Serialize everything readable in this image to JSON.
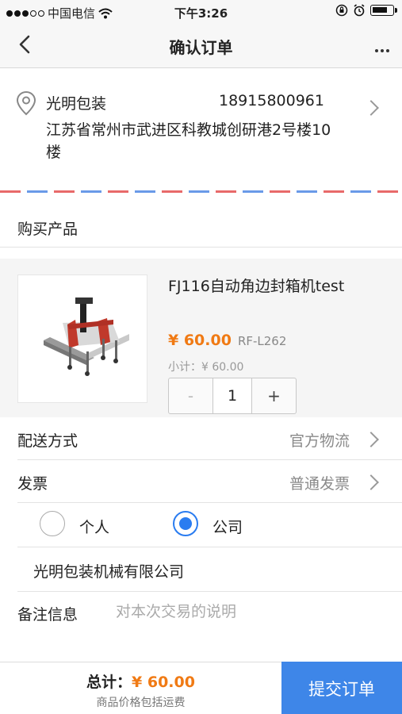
{
  "status_bar": {
    "carrier": "中国电信",
    "time": "下午3:26",
    "signal_bars_filled": 3,
    "signal_bars_total": 5,
    "battery_level": 0.8
  },
  "nav": {
    "title": "确认订单",
    "back_icon": "chevron-left-icon",
    "more_icon": "more-dots-icon"
  },
  "address": {
    "name": "光明包装",
    "phone": "18915800961",
    "detail": "江苏省常州市武进区科教城创研港2号楼10楼",
    "pin_icon": "location-pin-icon"
  },
  "products_section": {
    "title": "购买产品"
  },
  "product": {
    "name": "FJ116自动角边封箱机test",
    "price": "¥ 60.00",
    "sku": "RF-L262",
    "subtotal": "小计：¥ 60.00",
    "quantity": "1",
    "minus": "-",
    "plus": "+"
  },
  "delivery": {
    "label": "配送方式",
    "value": "官方物流"
  },
  "invoice": {
    "label": "发票",
    "value": "普通发票",
    "options": [
      "个人",
      "公司"
    ],
    "selected_index": 1,
    "company_name": "光明包装机械有限公司"
  },
  "notes": {
    "label": "备注信息",
    "placeholder": "对本次交易的说明",
    "value": ""
  },
  "footer": {
    "total_label": "总计：",
    "total_amount": "¥ 60.00",
    "note": "商品价格包括运费",
    "submit_label": "提交订单"
  },
  "colors": {
    "accent_blue": "#3e86e8",
    "price_orange": "#f07a14",
    "stripe_red": "#e86a6a",
    "stripe_blue": "#6a9ae8"
  }
}
